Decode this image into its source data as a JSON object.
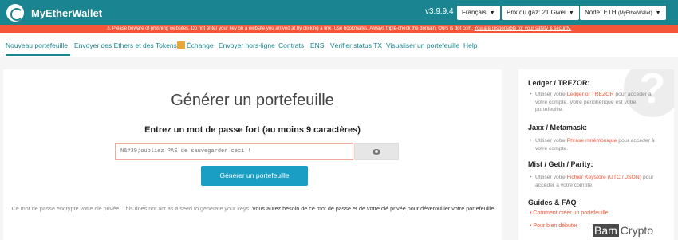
{
  "header": {
    "app_name": "MyEtherWallet",
    "version": "v3.9.9.4",
    "language": "Français",
    "gas_price": "Prix du gaz: 21 Gwei",
    "node": "Node: ETH",
    "node_sub": "(MyEtherWallet)"
  },
  "warning": {
    "text": "⚠ Please beware of phishing websites. Do not enter your key on a website you arrived at by clicking a link. Use bookmarks. Always triple-check the domain. Ours is dot com.",
    "link": "You are responsible for your safety & security."
  },
  "nav": {
    "items": [
      "Nouveau portefeuille",
      "Envoyer des Ethers et des Tokens",
      "Échange",
      "Envoyer hors-ligne",
      "Contrats",
      "ENS",
      "Vérifier status TX",
      "Visualiser un portefeuille",
      "Help"
    ]
  },
  "main": {
    "title": "Générer un portefeuille",
    "password_label": "Entrez un mot de passe fort (au moins 9 caractères)",
    "password_placeholder": "N&#39;oubliez PAS de sauvegarder ceci !",
    "generate_button": "Générer un portefeuille",
    "note_plain": "Ce mot de passe encrypte votre clé privée. This does not act as a seed to generate your keys.",
    "note_bold": "Vous aurez besoin de ce mot de passe et de votre clé privée pour déverouiller votre portefeuille."
  },
  "sidebar": {
    "ledger_heading": "Ledger / TREZOR:",
    "ledger_pre": "Utiliser votre",
    "ledger_link": "Ledger or TREZOR",
    "ledger_post": "pour accéder à votre compte. Votre périphérique est votre portefeuille.",
    "jaxx_heading": "Jaxx / Metamask:",
    "jaxx_pre": "Utiliser votre",
    "jaxx_link": "Phrase mnémonique",
    "jaxx_post": "pour accéder à votre compte.",
    "mist_heading": "Mist / Geth / Parity:",
    "mist_pre": "Utiliser votre",
    "mist_link": "Fichier Keystore (UTC / JSON)",
    "mist_post": "pour accéder à votre compte.",
    "guides_heading": "Guides & FAQ",
    "guide_1": "Comment créer un portefeuille",
    "guide_2": "Pour bien débuter",
    "help_glyph": "?"
  },
  "watermark": {
    "part_a": "Bam",
    "part_b": "Crypto"
  }
}
